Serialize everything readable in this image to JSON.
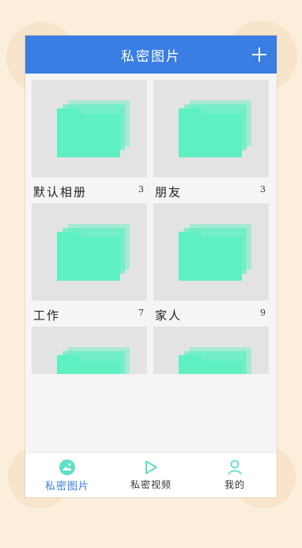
{
  "header": {
    "title": "私密图片",
    "add_icon": "plus-icon"
  },
  "albums": [
    {
      "name": "默认相册",
      "count": "3"
    },
    {
      "name": "朋友",
      "count": "3"
    },
    {
      "name": "工作",
      "count": "7"
    },
    {
      "name": "家人",
      "count": "9"
    },
    {
      "name": "",
      "count": ""
    },
    {
      "name": "",
      "count": ""
    }
  ],
  "tabs": [
    {
      "label": "私密图片",
      "icon": "image-icon",
      "active": true
    },
    {
      "label": "私密视频",
      "icon": "play-icon",
      "active": false
    },
    {
      "label": "我的",
      "icon": "person-icon",
      "active": false
    }
  ],
  "colors": {
    "header": "#3a7de3",
    "folder": "#5ef0c2",
    "background": "#fbefdc"
  }
}
